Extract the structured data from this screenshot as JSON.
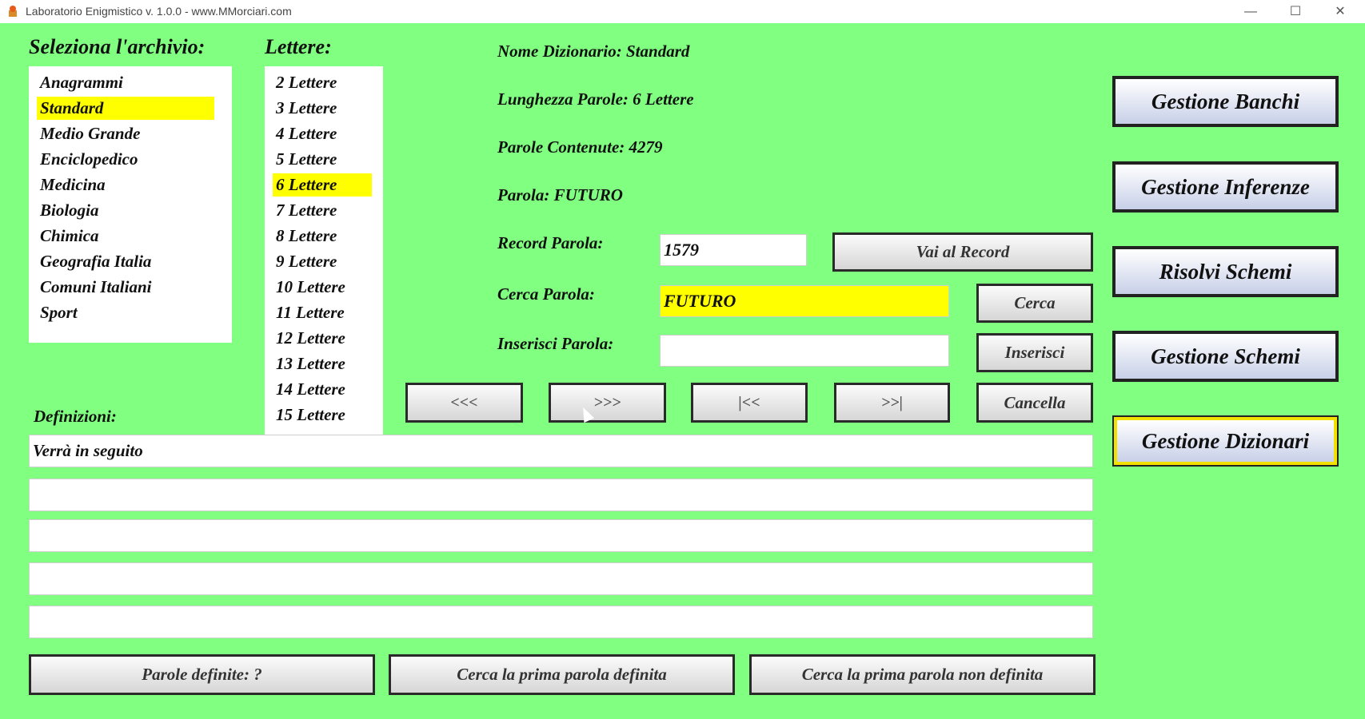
{
  "window": {
    "title": "Laboratorio Enigmistico v. 1.0.0 - www.MMorciari.com",
    "minimize": "—",
    "maximize": "☐",
    "close": "✕"
  },
  "archivio": {
    "label": "Seleziona l'archivio:",
    "items": [
      "Anagrammi",
      "Standard",
      "Medio Grande",
      "Enciclopedico",
      "Medicina",
      "Biologia",
      "Chimica",
      "Geografia Italia",
      "Comuni Italiani",
      "Sport"
    ],
    "selected": "Standard"
  },
  "lettere": {
    "label": "Lettere:",
    "items": [
      "2 Lettere",
      "3 Lettere",
      "4 Lettere",
      "5 Lettere",
      "6 Lettere",
      "7 Lettere",
      "8 Lettere",
      "9 Lettere",
      "10 Lettere",
      "11 Lettere",
      "12 Lettere",
      "13 Lettere",
      "14 Lettere",
      "15 Lettere"
    ],
    "selected": "6 Lettere"
  },
  "info": {
    "nome_dizionario": "Nome Dizionario: Standard",
    "lunghezza_parole": "Lunghezza Parole: 6 Lettere",
    "parole_contenute": "Parole Contenute: 4279",
    "parola": "Parola: FUTURO"
  },
  "record": {
    "label": "Record Parola:",
    "value": "1579",
    "button": "Vai al Record"
  },
  "cerca": {
    "label": "Cerca Parola:",
    "value": "FUTURO",
    "button": "Cerca"
  },
  "inserisci": {
    "label": "Inserisci Parola:",
    "value": "",
    "button": "Inserisci"
  },
  "nav": {
    "prev": "<<<",
    "next": ">>>",
    "first": "|<<",
    "last": ">>|",
    "delete": "Cancella"
  },
  "definizioni": {
    "label": "Definizioni:",
    "values": [
      "Verrà in seguito",
      "",
      "",
      "",
      ""
    ]
  },
  "bottom_buttons": {
    "parole_definite": "Parole definite: ?",
    "cerca_prima_definita": "Cerca la prima parola definita",
    "cerca_prima_non_definita": "Cerca la prima parola non definita"
  },
  "side_buttons": [
    "Gestione Banchi",
    "Gestione Inferenze",
    "Risolvi Schemi",
    "Gestione Schemi",
    "Gestione Dizionari"
  ],
  "colors": {
    "background": "#80ff80",
    "highlight": "#ffff00"
  }
}
